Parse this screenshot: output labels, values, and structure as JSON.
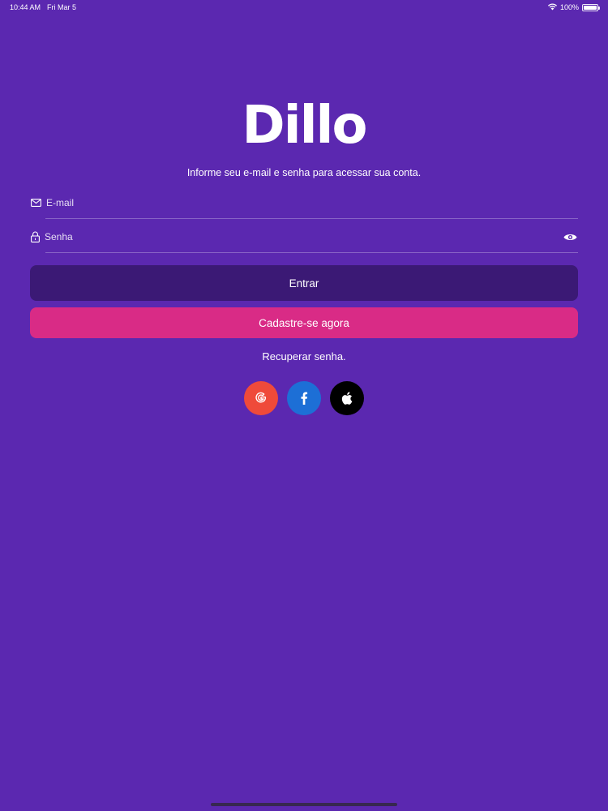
{
  "status_bar": {
    "time": "10:44 AM",
    "date": "Fri Mar 5",
    "battery": "100%",
    "battery_level": 1.0
  },
  "logo": {
    "text": "Dillo"
  },
  "subtitle": "Informe seu e-mail e senha para acessar sua conta.",
  "form": {
    "email": {
      "placeholder": "E-mail",
      "value": "",
      "icon": "envelope-icon"
    },
    "password": {
      "placeholder": "Senha",
      "value": "",
      "icon": "lock-icon",
      "toggle_icon": "eye-icon"
    }
  },
  "buttons": {
    "login": "Entrar",
    "signup": "Cadastre-se agora"
  },
  "recover_link": "Recuperar senha.",
  "social_logins": [
    {
      "name": "google",
      "glyph": "G",
      "color": "#ef4a3a"
    },
    {
      "name": "facebook",
      "glyph": "f",
      "color": "#1d6fd6"
    },
    {
      "name": "apple",
      "glyph": "",
      "color": "#000000"
    }
  ],
  "colors": {
    "background": "#5b28b0",
    "primary_button": "#3b1975",
    "secondary_button": "#d92b86"
  }
}
